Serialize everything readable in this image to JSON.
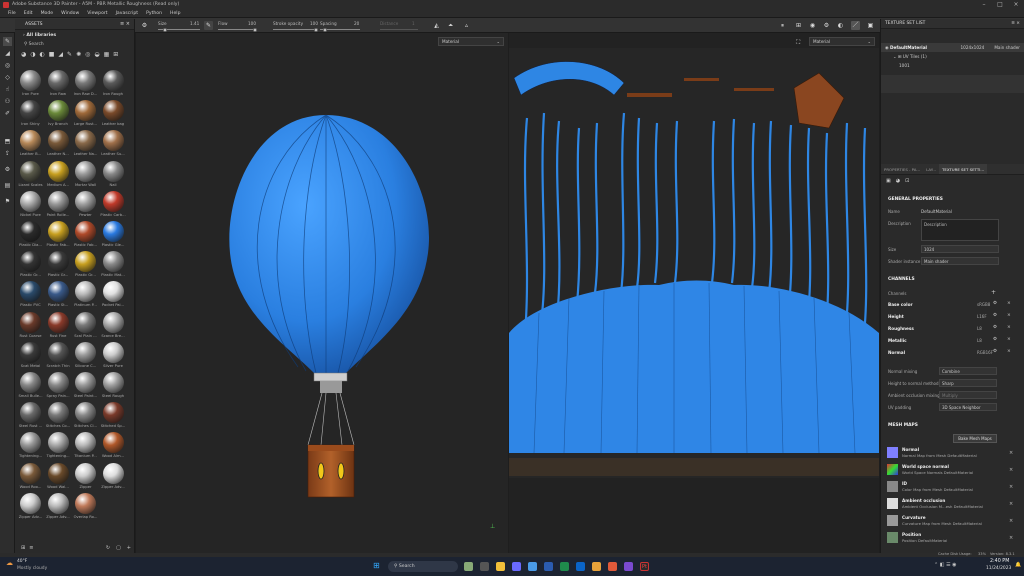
{
  "window": {
    "title": "Adobe Substance 3D Painter - A5M - PBR Metallic Roughness (Read only)"
  },
  "menu": [
    "File",
    "Edit",
    "Mode",
    "Window",
    "Viewport",
    "Javascript",
    "Python",
    "Help"
  ],
  "toolbar": {
    "size_label": "Size",
    "size_value": "1.41",
    "flow_label": "Flow",
    "flow_value": "100",
    "stroke_label": "Stroke opacity",
    "stroke_value": "100",
    "spacing_label": "Spacing",
    "spacing_value": "20",
    "distance_label": "Distance",
    "distance_value": "1"
  },
  "assets": {
    "title": "ASSETS",
    "library": "All libraries",
    "search_placeholder": "Search",
    "items": [
      "Iron Pure",
      "Iron Raw",
      "Iron Raw D...",
      "Iron Rough",
      "Iron Shiny",
      "Ivy Branch",
      "Large Rust...",
      "Leather bag",
      "Leather B...",
      "Leather N...",
      "Leather Na...",
      "Leather Su...",
      "Lizard Scales",
      "Medium A...",
      "Mortar Wall",
      "Nail",
      "Nickel Pure",
      "Paint Rolle...",
      "Pewter",
      "Plastic Carb...",
      "Plastic Dia...",
      "Plastic Fab...",
      "Plastic Fab...",
      "Plastic Gle...",
      "Plastic Gr...",
      "Plastic Gr...",
      "Plastic Gr...",
      "Plastic Mat...",
      "Plastic PVC",
      "Plastic St...",
      "Platinum P...",
      "Pocket Pai...",
      "Rust Coarse",
      "Rust Fine",
      "Scal Plain ...",
      "Scarce Bre...",
      "Scat Metal",
      "Scratch Thin",
      "Silicone C...",
      "Silver Pure",
      "Small Bulle...",
      "Spray Pain...",
      "Steel Paint...",
      "Steel Rough",
      "Steel Rust ...",
      "Stitches Co...",
      "Stitches Cl...",
      "Stitched Sp...",
      "Tightening...",
      "Tightening...",
      "Titanium P...",
      "Wood Alm...",
      "Wood Roo...",
      "Wood Wal...",
      "Zipper",
      "Zipper Adv...",
      "Zipper Adv...",
      "Zipper Adv...",
      "Overlap Ro..."
    ]
  },
  "viewport3d": {
    "mode": "Material"
  },
  "viewport2d": {
    "mode": "Material"
  },
  "texture_set_list": {
    "title": "TEXTURE SET LIST",
    "set_name": "DefaultMaterial",
    "resolution": "1024x1024",
    "shader": "Main shader",
    "uv_tiles": "UV Tiles (1)",
    "tile": "1001"
  },
  "properties": {
    "tabs": [
      "PROPERTIES - PA...",
      "LAY...",
      "TEXTURE SET SETTI..."
    ],
    "general": "GENERAL PROPERTIES",
    "name_label": "Name",
    "name_value": "DefaultMaterial",
    "desc_label": "Description",
    "desc_value": "Description",
    "size_label": "Size",
    "size_value": "1024",
    "shader_label": "Shader instance",
    "shader_value": "Main shader",
    "channels_title": "CHANNELS",
    "channels_label": "Channels",
    "channels": [
      {
        "name": "Base color",
        "fmt": "sRGB8"
      },
      {
        "name": "Height",
        "fmt": "L16F"
      },
      {
        "name": "Roughness",
        "fmt": "L8"
      },
      {
        "name": "Metallic",
        "fmt": "L8"
      },
      {
        "name": "Normal",
        "fmt": "RGB16F"
      }
    ],
    "normal_mixing_label": "Normal mixing",
    "normal_mixing_value": "Combine",
    "h2n_label": "Height to normal method",
    "h2n_value": "Sharp",
    "ao_label": "Ambient occlusion mixing",
    "ao_value": "Multiply",
    "uv_label": "UV padding",
    "uv_value": "3D Space Neighbor",
    "mesh_title": "MESH MAPS",
    "bake_button": "Bake Mesh Maps",
    "maps": [
      {
        "title": "Normal",
        "sub": "Normal Map from Mesh DefaultMaterial"
      },
      {
        "title": "World space normal",
        "sub": "World Space Normals DefaultMaterial"
      },
      {
        "title": "ID",
        "sub": "Color Map from Mesh DefaultMaterial"
      },
      {
        "title": "Ambient occlusion",
        "sub": "Ambient Occlusion M...esh DefaultMaterial"
      },
      {
        "title": "Curvature",
        "sub": "Curvature Map from Mesh DefaultMaterial"
      },
      {
        "title": "Position",
        "sub": "Position DefaultMaterial"
      }
    ]
  },
  "status": {
    "cache": "Cache Disk Usage:",
    "pct": "33%",
    "version": "Version: 8.3.1"
  },
  "taskbar": {
    "temp": "40°F",
    "weather": "Mostly cloudy",
    "search": "Search",
    "time": "2:40 PM",
    "date": "11/24/2023"
  },
  "colors": {
    "balloon": "#2f86e6",
    "accent": "#3a8ee6"
  }
}
